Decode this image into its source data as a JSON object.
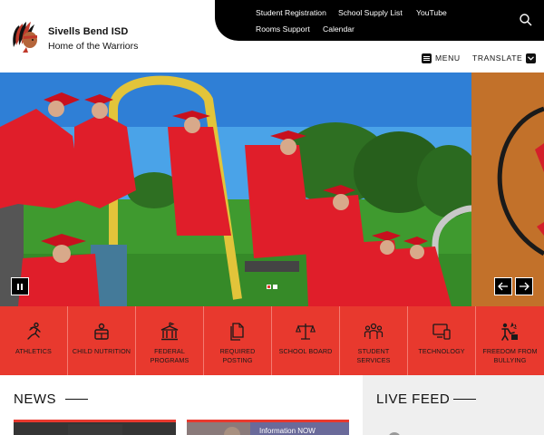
{
  "header": {
    "school_name": "Sivells Bend ISD",
    "tagline": "Home of the Warriors",
    "logo_icon": "warrior-logo-icon"
  },
  "topbar": {
    "links": [
      "Student Registration",
      "School Supply List",
      "YouTube",
      "Rooms Support",
      "Calendar"
    ],
    "search_icon": "search-icon"
  },
  "nav": {
    "menu_label": "MENU",
    "translate_label": "TRANSLATE"
  },
  "slideshow": {
    "pause_icon": "pause-icon",
    "prev_icon": "arrow-left-icon",
    "next_icon": "arrow-right-icon",
    "dots_count": 2,
    "active_dot": 1
  },
  "quicklinks": {
    "items": [
      {
        "label": "ATHLETICS",
        "icon": "runner-icon"
      },
      {
        "label": "CHILD NUTRITION",
        "icon": "food-tray-icon"
      },
      {
        "label": "FEDERAL PROGRAMS",
        "icon": "government-building-icon"
      },
      {
        "label": "REQUIRED POSTING",
        "icon": "documents-icon"
      },
      {
        "label": "SCHOOL BOARD",
        "icon": "scales-icon"
      },
      {
        "label": "STUDENT SERVICES",
        "icon": "people-icon"
      },
      {
        "label": "TECHNOLOGY",
        "icon": "devices-icon"
      },
      {
        "label": "FREEDOM FROM BULLYING",
        "icon": "support-icon"
      }
    ]
  },
  "news": {
    "title": "NEWS",
    "card2_text": "Information NOW"
  },
  "live_feed": {
    "title": "LIVE FEED"
  },
  "colors": {
    "accent_red": "#e8392e",
    "topbar_black": "#000000",
    "live_feed_bg": "#efefef"
  }
}
